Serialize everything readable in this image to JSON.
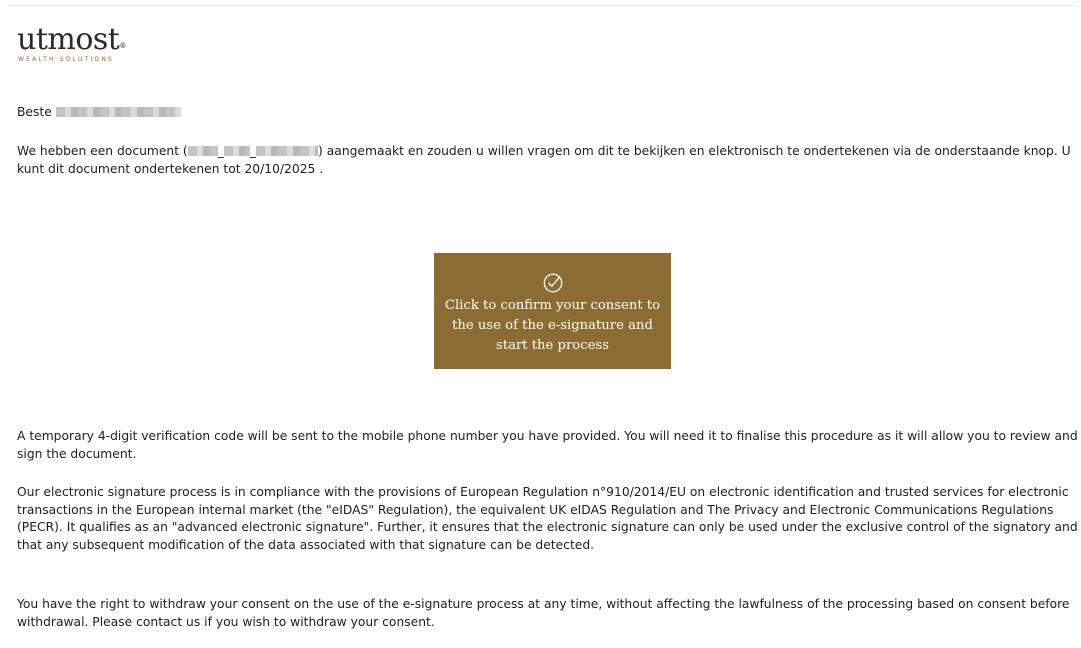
{
  "brand": {
    "name": "utmost",
    "trademark": "®",
    "tagline": "WEALTH SOLUTIONS",
    "accent_color": "#8b6c33"
  },
  "email": {
    "greeting": "Beste",
    "intro_before_doc": "We hebben een document (",
    "doc_separator_1": "_",
    "doc_separator_2": "_",
    "intro_after_doc": ") aangemaakt en zouden u willen vragen om dit te bekijken en elektronisch te ondertekenen via de onderstaande knop. U kunt dit document ondertekenen tot 20/10/2025 .",
    "button": {
      "icon": "check-circle-icon",
      "label": "Click to confirm your consent to the use of the e-signature and start the process"
    },
    "paragraph_verification": "A temporary 4-digit verification code will be sent to the mobile phone number you have provided. You will need it to finalise this procedure as it will allow you to review and sign the document.",
    "paragraph_compliance": "Our electronic signature process is in compliance with the provisions of European Regulation n°910/2014/EU on electronic identification and trusted services for electronic transactions in the European internal market (the \"eIDAS\" Regulation), the equivalent UK eIDAS Regulation and The Privacy and Electronic Communications Regulations (PECR). It qualifies as an \"advanced electronic signature\". Further, it ensures that the electronic signature can only be used under the exclusive control of the signatory and that any subsequent modification of the data associated with that signature can be detected.",
    "paragraph_withdraw": "You have the right to withdraw your consent on the use of the e-signature process at any time, without affecting the lawfulness of the processing based on consent before withdrawal. Please contact us if you wish to withdraw your consent."
  }
}
